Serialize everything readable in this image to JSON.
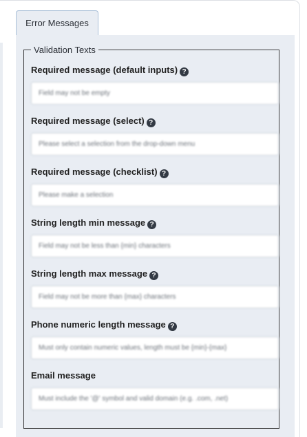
{
  "tabs": [
    {
      "label": "Error Messages",
      "active": true
    }
  ],
  "fieldset": {
    "legend": "Validation Texts"
  },
  "fields": [
    {
      "label": "Required message (default inputs)",
      "has_help": true,
      "value": "Field may not be empty"
    },
    {
      "label": "Required message (select)",
      "has_help": true,
      "value": "Please select a selection from the drop-down menu"
    },
    {
      "label": "Required message (checklist)",
      "has_help": true,
      "value": "Please make a selection"
    },
    {
      "label": "String length min message",
      "has_help": true,
      "value": "Field may not be less than {min} characters"
    },
    {
      "label": "String length max message",
      "has_help": true,
      "value": "Field may not be more than {max} characters"
    },
    {
      "label": "Phone numeric length message",
      "has_help": true,
      "value": "Must only contain numeric values, length must be {min}-{max}"
    },
    {
      "label": "Email message",
      "has_help": false,
      "value": "Must include the '@' symbol and valid domain (e.g. .com, .net)"
    }
  ],
  "icons": {
    "help": "question-circle-icon"
  },
  "colors": {
    "panel_bg": "#e9edf3",
    "tab_border": "#a9bfd8",
    "input_border": "#cdd3db"
  }
}
